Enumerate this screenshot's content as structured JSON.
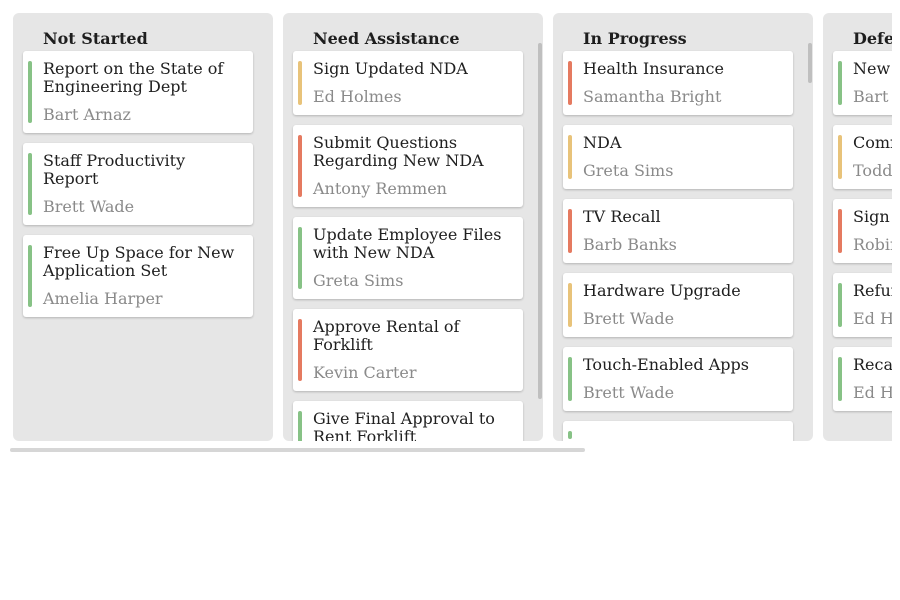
{
  "colors": {
    "green": "#87c286",
    "amber": "#e8c37a",
    "red": "#e57a60",
    "column_bg": "#e6e6e6",
    "card_bg": "#ffffff"
  },
  "columns": [
    {
      "title": "Not Started",
      "cards": [
        {
          "title": "Report on the State of Engineering Dept",
          "assignee": "Bart Arnaz",
          "priority": "green"
        },
        {
          "title": "Staff Productivity Report",
          "assignee": "Brett Wade",
          "priority": "green"
        },
        {
          "title": "Free Up Space for New Application Set",
          "assignee": "Amelia Harper",
          "priority": "green"
        }
      ]
    },
    {
      "title": "Need Assistance",
      "cards": [
        {
          "title": "Sign Updated NDA",
          "assignee": "Ed Holmes",
          "priority": "amber"
        },
        {
          "title": "Submit Questions Regarding New NDA",
          "assignee": "Antony Remmen",
          "priority": "red"
        },
        {
          "title": "Update Employee Files with New NDA",
          "assignee": "Greta Sims",
          "priority": "green"
        },
        {
          "title": "Approve Rental of Forklift",
          "assignee": "Kevin Carter",
          "priority": "red"
        },
        {
          "title": "Give Final Approval to Rent Forklift",
          "assignee": "",
          "priority": "green"
        }
      ]
    },
    {
      "title": "In Progress",
      "cards": [
        {
          "title": "Health Insurance",
          "assignee": "Samantha Bright",
          "priority": "red"
        },
        {
          "title": "NDA",
          "assignee": "Greta Sims",
          "priority": "amber"
        },
        {
          "title": "TV Recall",
          "assignee": "Barb Banks",
          "priority": "red"
        },
        {
          "title": "Hardware Upgrade",
          "assignee": "Brett Wade",
          "priority": "amber"
        },
        {
          "title": "Touch-Enabled Apps",
          "assignee": "Brett Wade",
          "priority": "green"
        },
        {
          "title": "",
          "assignee": "",
          "priority": "green"
        }
      ]
    },
    {
      "title": "Deferred",
      "cards": [
        {
          "title": "New H",
          "assignee": "Bart A",
          "priority": "green"
        },
        {
          "title": "Comm Project",
          "assignee": "Todd I",
          "priority": "amber"
        },
        {
          "title": "Sign F",
          "assignee": "Robin",
          "priority": "red"
        },
        {
          "title": "Refun",
          "assignee": "Ed Ho",
          "priority": "green"
        },
        {
          "title": "Recall",
          "assignee": "Ed Ho",
          "priority": "green"
        }
      ]
    }
  ]
}
